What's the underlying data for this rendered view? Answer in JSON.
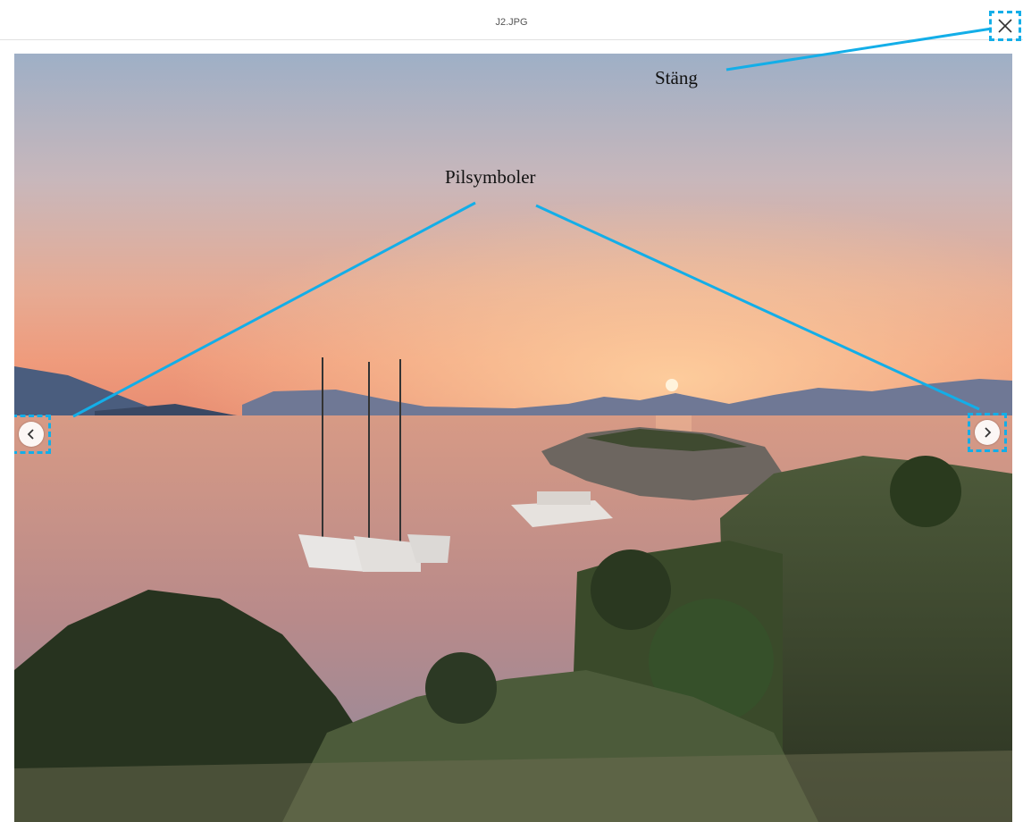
{
  "header": {
    "filename": "J2.JPG"
  },
  "icons": {
    "close": "close-icon",
    "prev": "chevron-left-icon",
    "next": "chevron-right-icon"
  },
  "annotations": {
    "close_label": "Stäng",
    "arrows_label": "Pilsymboler"
  },
  "colors": {
    "callout_line": "#13aee8",
    "sky_top": "#9fb0c6",
    "sky_horizon": "#f0a87a",
    "sun": "#ffe9c8",
    "water": "#c48f87"
  }
}
